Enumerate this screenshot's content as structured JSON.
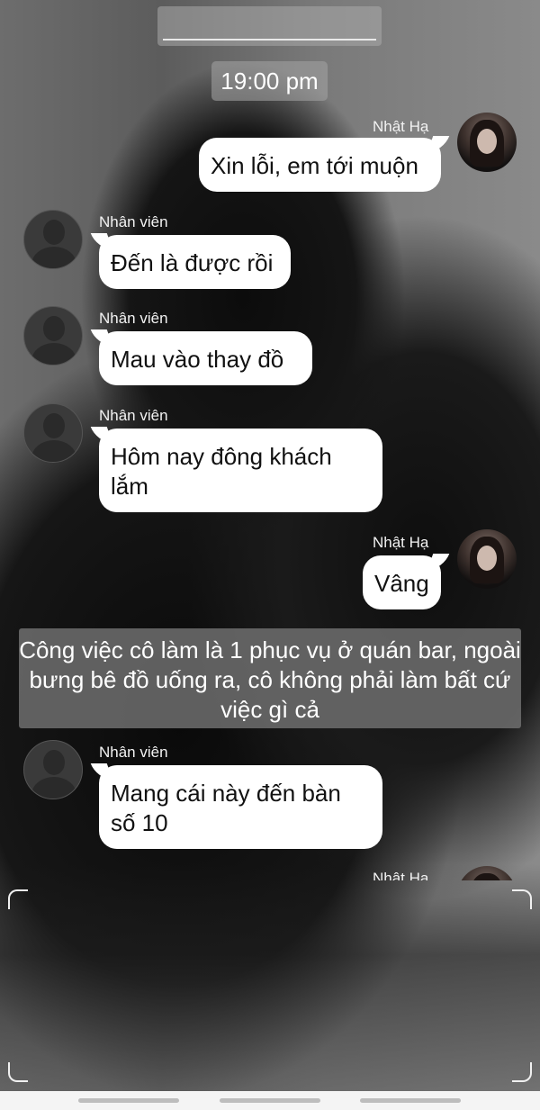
{
  "header": {
    "time": "19:00 pm"
  },
  "messages": [
    {
      "sender": "Nhật Hạ",
      "side": "right",
      "text": "Xin lỗi, em tới muộn"
    },
    {
      "sender": "Nhân viên",
      "side": "left",
      "text": "Đến là được rồi"
    },
    {
      "sender": "Nhân viên",
      "side": "left",
      "text": "Mau vào thay đồ"
    },
    {
      "sender": "Nhân viên",
      "side": "left",
      "text": "Hôm nay đông khách lắm"
    },
    {
      "sender": "Nhật Hạ",
      "side": "right",
      "text": "Vâng"
    },
    {
      "sender": "Nhân viên",
      "side": "left",
      "text": "Mang cái này đến bàn số 10"
    },
    {
      "sender": "Nhật Hạ",
      "side": "right",
      "text": ""
    }
  ],
  "narration": "Công việc cô làm là 1 phục vụ ở quán bar, ngoài bưng bê đồ uống ra, cô không phải làm bất cứ việc gì cả"
}
